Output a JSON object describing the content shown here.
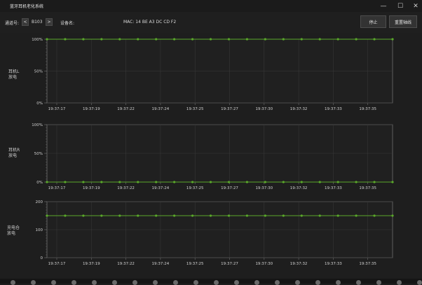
{
  "window": {
    "title": "蓝牙耳机老化系统",
    "minimize_label": "—",
    "maximize_label": "☐",
    "close_label": "✕"
  },
  "toolbar": {
    "channel_label": "通道号:",
    "channel_value": "B103",
    "prev_label": "<",
    "next_label": ">",
    "device_label": "设备名:",
    "mac_text": "MAC:  14 BE A3 DC CD F2",
    "stop_label": "停止",
    "reset_axis_label": "重置轴线"
  },
  "rows": [
    {
      "title_line1": "耳机L",
      "title_line2": "放电"
    },
    {
      "title_line1": "耳机R",
      "title_line2": "放电"
    },
    {
      "title_line1": "充电仓",
      "title_line2": "放电"
    }
  ],
  "colors": {
    "series": "#5aa82a",
    "plot_border": "#6e6e6e",
    "grid": "#3a3a3a"
  },
  "chart_data": [
    {
      "type": "line",
      "title": "",
      "ylabel": "耳机L 放电",
      "y_ticks": [
        "0%",
        "50%",
        "100%"
      ],
      "ylim": [
        0,
        100
      ],
      "x_ticks": [
        "19:37:17",
        "19:37:19",
        "19:37:22",
        "19:37:24",
        "19:37:25",
        "19:37:27",
        "19:37:30",
        "19:37:32",
        "19:37:33",
        "19:37:35"
      ],
      "series": [
        {
          "values": [
            100,
            100,
            100,
            100,
            100,
            100,
            100,
            100,
            100,
            100,
            100,
            100,
            100,
            100,
            100,
            100,
            100,
            100,
            100,
            100
          ]
        }
      ]
    },
    {
      "type": "line",
      "title": "",
      "ylabel": "耳机R 放电",
      "y_ticks": [
        "0%",
        "50%",
        "100%"
      ],
      "ylim": [
        0,
        100
      ],
      "x_ticks": [
        "19:37:17",
        "19:37:19",
        "19:37:22",
        "19:37:24",
        "19:37:25",
        "19:37:27",
        "19:37:30",
        "19:37:32",
        "19:37:33",
        "19:37:35"
      ],
      "series": [
        {
          "values": [
            0,
            0,
            0,
            0,
            0,
            0,
            0,
            0,
            0,
            0,
            0,
            0,
            0,
            0,
            0,
            0,
            0,
            0,
            0,
            0
          ]
        }
      ]
    },
    {
      "type": "line",
      "title": "",
      "ylabel": "充电仓 放电",
      "y_ticks": [
        "0",
        "100",
        "200"
      ],
      "ylim": [
        0,
        200
      ],
      "x_ticks": [
        "19:37:17",
        "19:37:19",
        "19:37:22",
        "19:37:24",
        "19:37:25",
        "19:37:27",
        "19:37:30",
        "19:37:32",
        "19:37:33",
        "19:37:35"
      ],
      "series": [
        {
          "values": [
            150,
            150,
            150,
            150,
            150,
            150,
            150,
            150,
            150,
            150,
            150,
            150,
            150,
            150,
            150,
            150,
            150,
            150,
            150,
            150
          ]
        }
      ]
    }
  ]
}
